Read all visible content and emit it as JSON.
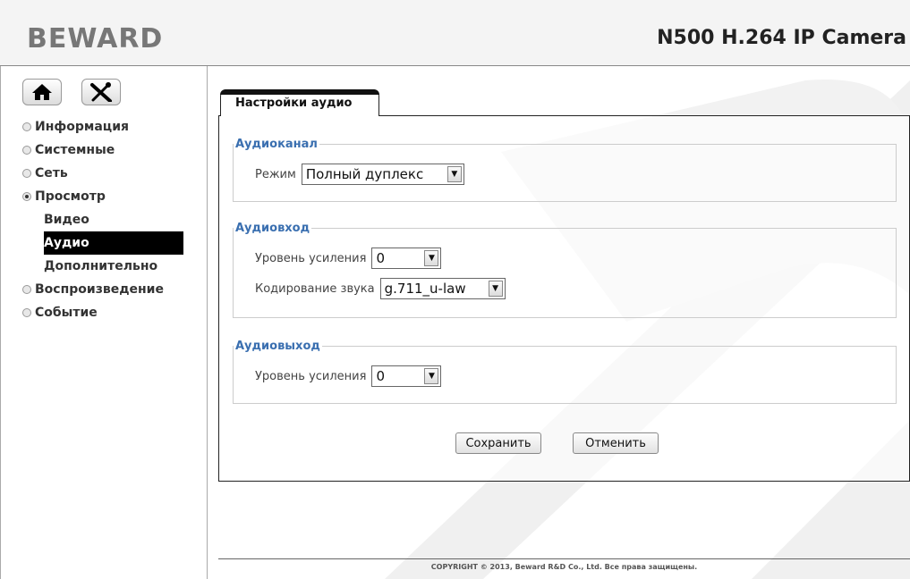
{
  "header": {
    "logo": "BEWARD",
    "product": "N500 H.264 IP Camera"
  },
  "sidebar": {
    "icons": [
      "home-icon",
      "tools-icon"
    ],
    "menu": [
      {
        "label": "Информация",
        "expanded": false
      },
      {
        "label": "Системные",
        "expanded": false
      },
      {
        "label": "Сеть",
        "expanded": false
      },
      {
        "label": "Просмотр",
        "expanded": true
      }
    ],
    "submenu": [
      {
        "label": "Видео",
        "active": false
      },
      {
        "label": "Аудио",
        "active": true
      },
      {
        "label": "Дополнительно",
        "active": false
      }
    ],
    "menu_after": [
      {
        "label": "Воспроизведение",
        "expanded": false
      },
      {
        "label": "Событие",
        "expanded": false
      }
    ]
  },
  "main": {
    "tab_label": "Настройки аудио",
    "audio_channel": {
      "legend": "Аудиоканал",
      "mode_label": "Режим",
      "mode_value": "Полный дуплекс"
    },
    "audio_in": {
      "legend": "Аудиовход",
      "gain_label": "Уровень усиления",
      "gain_value": "0",
      "codec_label": "Кодирование звука",
      "codec_value": "g.711_u-law"
    },
    "audio_out": {
      "legend": "Аудиовыход",
      "gain_label": "Уровень усиления",
      "gain_value": "0"
    },
    "save_label": "Сохранить",
    "cancel_label": "Отменить"
  },
  "footer": {
    "copyright": "COPYRIGHT © 2013, Beward R&D Co., Ltd. Все права защищены."
  },
  "colors": {
    "accent": "#3a6fb0",
    "active_bg": "#000000"
  }
}
